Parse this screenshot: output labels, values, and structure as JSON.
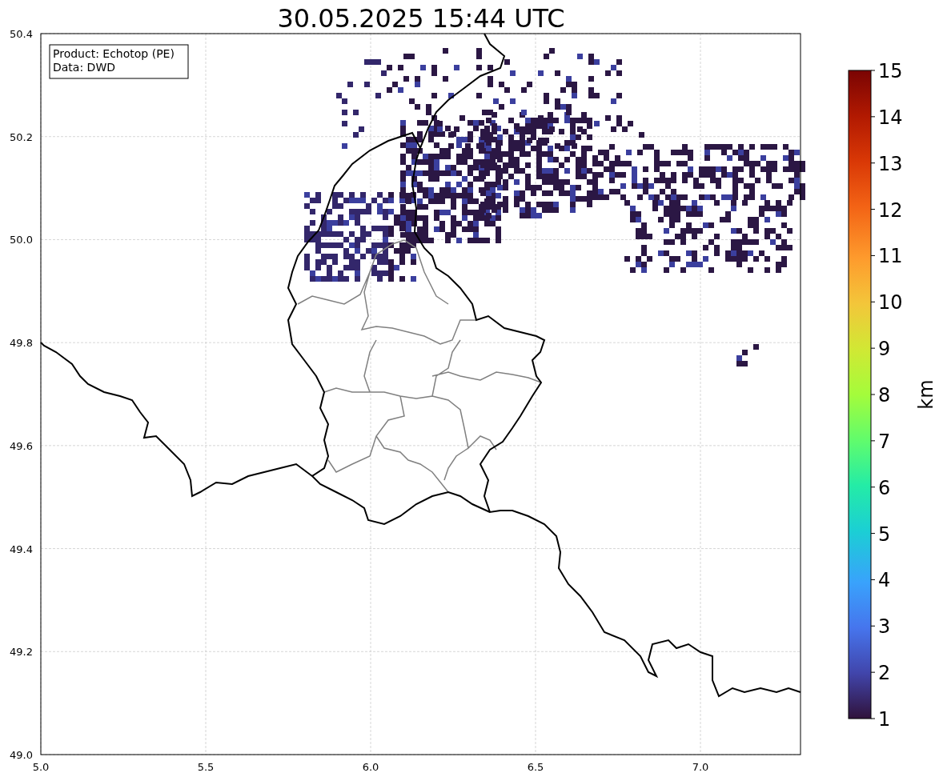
{
  "title": "30.05.2025 15:44 UTC",
  "info_box": {
    "lines": [
      "Product: Echotop (PE)",
      "Data: DWD"
    ]
  },
  "map": {
    "x_ticks": [
      "5.0",
      "5.5",
      "6.0",
      "6.5",
      "7.0"
    ],
    "y_ticks": [
      "50.4",
      "50.2",
      "50.0",
      "49.8",
      "49.6",
      "49.4",
      "49.2",
      "49.0"
    ]
  },
  "colorbar": {
    "ticks": [
      "15",
      "14",
      "13",
      "12",
      "11",
      "10",
      "9",
      "8",
      "7",
      "6",
      "5",
      "4",
      "3",
      "2",
      "1"
    ],
    "label": "km"
  }
}
